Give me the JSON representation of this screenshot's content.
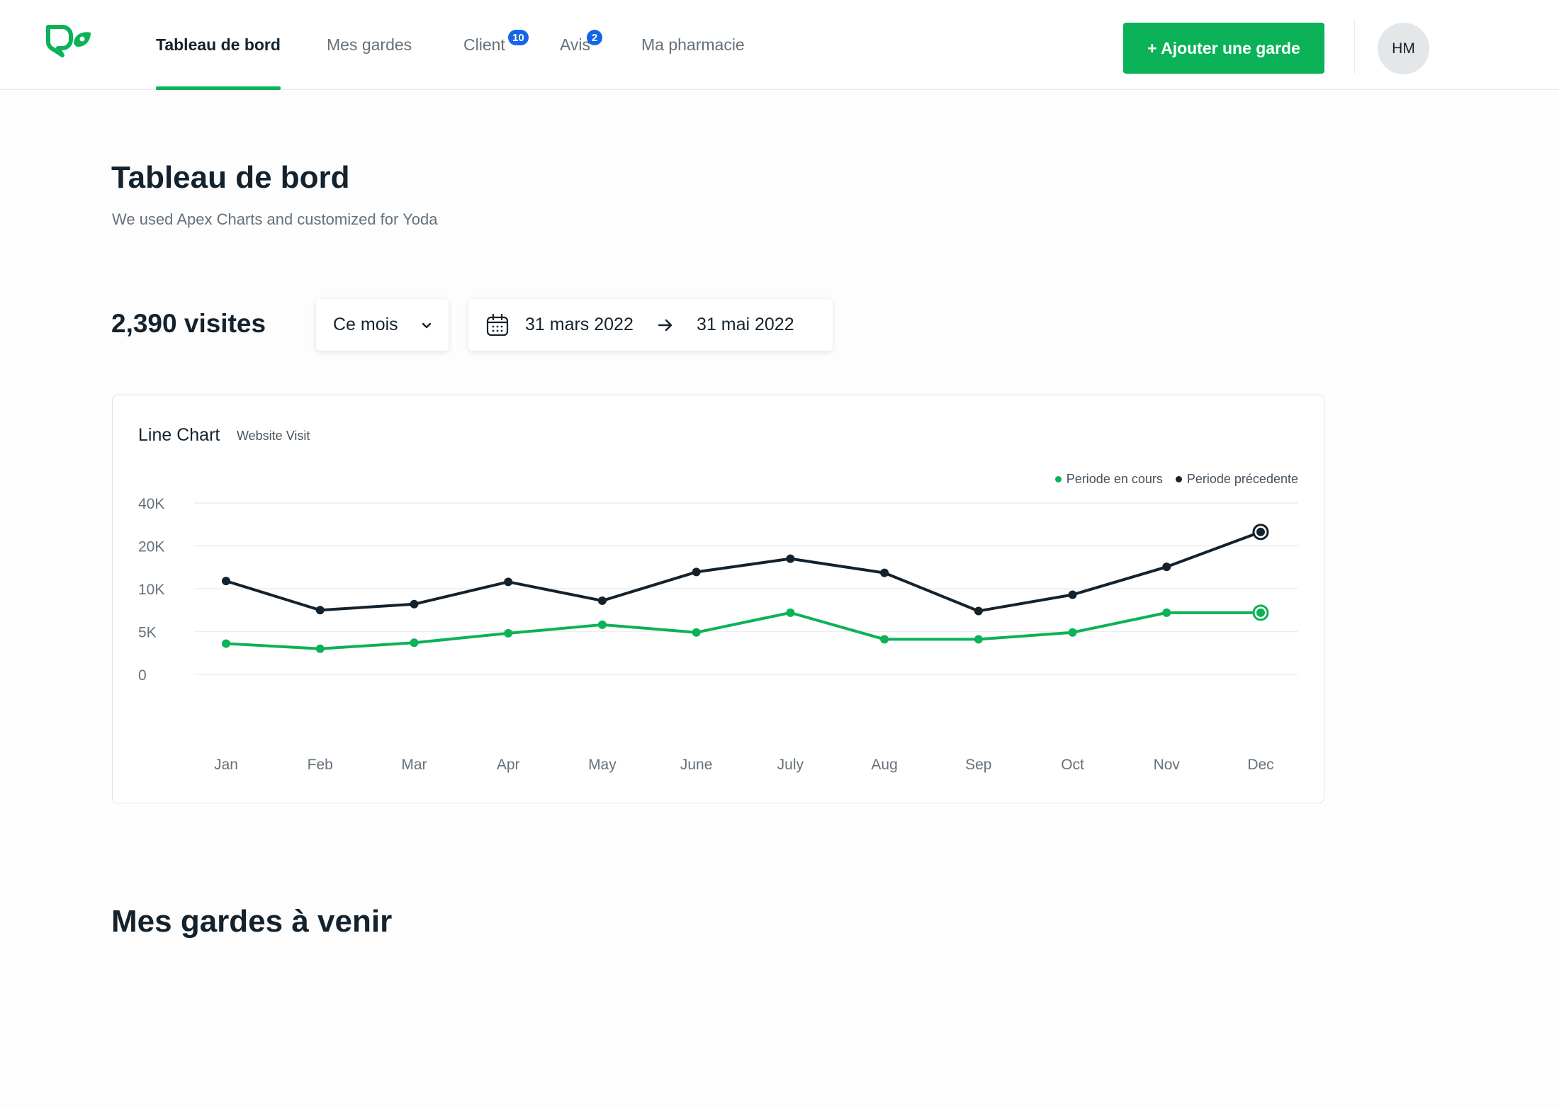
{
  "nav": {
    "items": [
      {
        "label": "Tableau de bord",
        "active": true
      },
      {
        "label": "Mes gardes"
      },
      {
        "label": "Client",
        "badge": "10"
      },
      {
        "label": "Avis",
        "badge": "2"
      },
      {
        "label": "Ma pharmacie"
      }
    ],
    "add_button_label": "+ Ajouter une garde",
    "avatar_initials": "HM"
  },
  "page": {
    "title": "Tableau de bord",
    "subtitle": "We used Apex Charts and customized for Yoda"
  },
  "stats": {
    "visits_label": "2,390 visites",
    "period_select": "Ce mois",
    "date_from": "31 mars 2022",
    "date_to": "31 mai 2022"
  },
  "chart_card": {
    "title": "Line Chart",
    "subtitle": "Website Visit"
  },
  "chart_data": {
    "type": "line",
    "categories": [
      "Jan",
      "Feb",
      "Mar",
      "Apr",
      "May",
      "June",
      "July",
      "Aug",
      "Sep",
      "Oct",
      "Nov",
      "Dec"
    ],
    "y_ticks": [
      0,
      5000,
      10000,
      20000,
      40000
    ],
    "y_tick_labels": [
      "0",
      "5K",
      "10K",
      "20K",
      "40K"
    ],
    "y_scale": "non-uniform (0, 5K, 10K, 20K, 40K equally spaced)",
    "grid": true,
    "legend_position": "top-right",
    "series": [
      {
        "name": "Periode en cours",
        "color": "#0bb257",
        "values": [
          3600,
          3000,
          3700,
          4800,
          5800,
          4900,
          7200,
          4100,
          4100,
          4900,
          7200,
          7200
        ]
      },
      {
        "name": "Periode précedente",
        "color": "#14222d",
        "values": [
          11800,
          7500,
          8200,
          11600,
          8600,
          13900,
          17000,
          13700,
          7400,
          9300,
          15100,
          26500
        ]
      }
    ]
  },
  "upcoming": {
    "title": "Mes gardes à venir"
  },
  "colors": {
    "accent": "#0bb257",
    "dark": "#14222d",
    "badge": "#1566e6",
    "muted_text": "#66717a"
  }
}
